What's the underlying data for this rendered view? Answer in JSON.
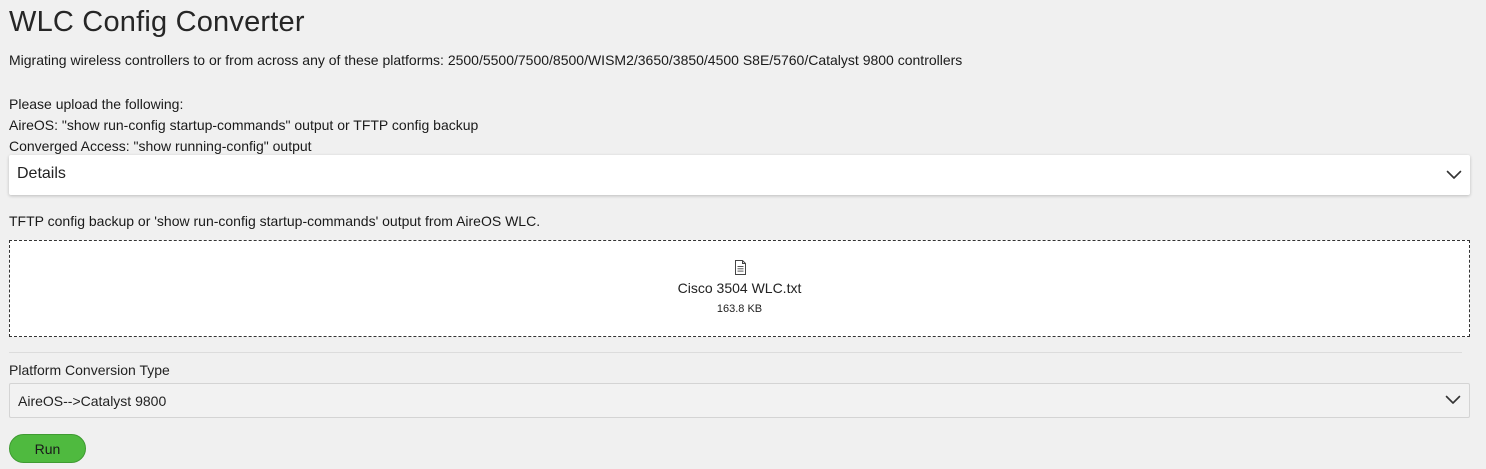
{
  "page": {
    "title": "WLC Config Converter",
    "subtitle": "Migrating wireless controllers to or from across any of these platforms: 2500/5500/7500/8500/WISM2/3650/3850/4500 S8E/5760/Catalyst 9800 controllers",
    "instructions": [
      "Please upload the following:",
      "AireOS: \"show run-config startup-commands\" output or TFTP config backup",
      "Converged Access: \"show running-config\" output"
    ]
  },
  "details": {
    "label": "Details",
    "icon": "chevron-down-icon"
  },
  "upload": {
    "label": "TFTP config backup or 'show run-config startup-commands' output from AireOS WLC.",
    "file_icon": "document-icon",
    "file_name": "Cisco 3504 WLC.txt",
    "file_size": "163.8 KB"
  },
  "conversion": {
    "label": "Platform Conversion Type",
    "selected": "AireOS-->Catalyst 9800",
    "icon": "chevron-down-icon"
  },
  "actions": {
    "run_label": "Run"
  },
  "colors": {
    "background": "#f0f0f0",
    "run_button": "#4fba3f",
    "panel": "#ffffff"
  }
}
